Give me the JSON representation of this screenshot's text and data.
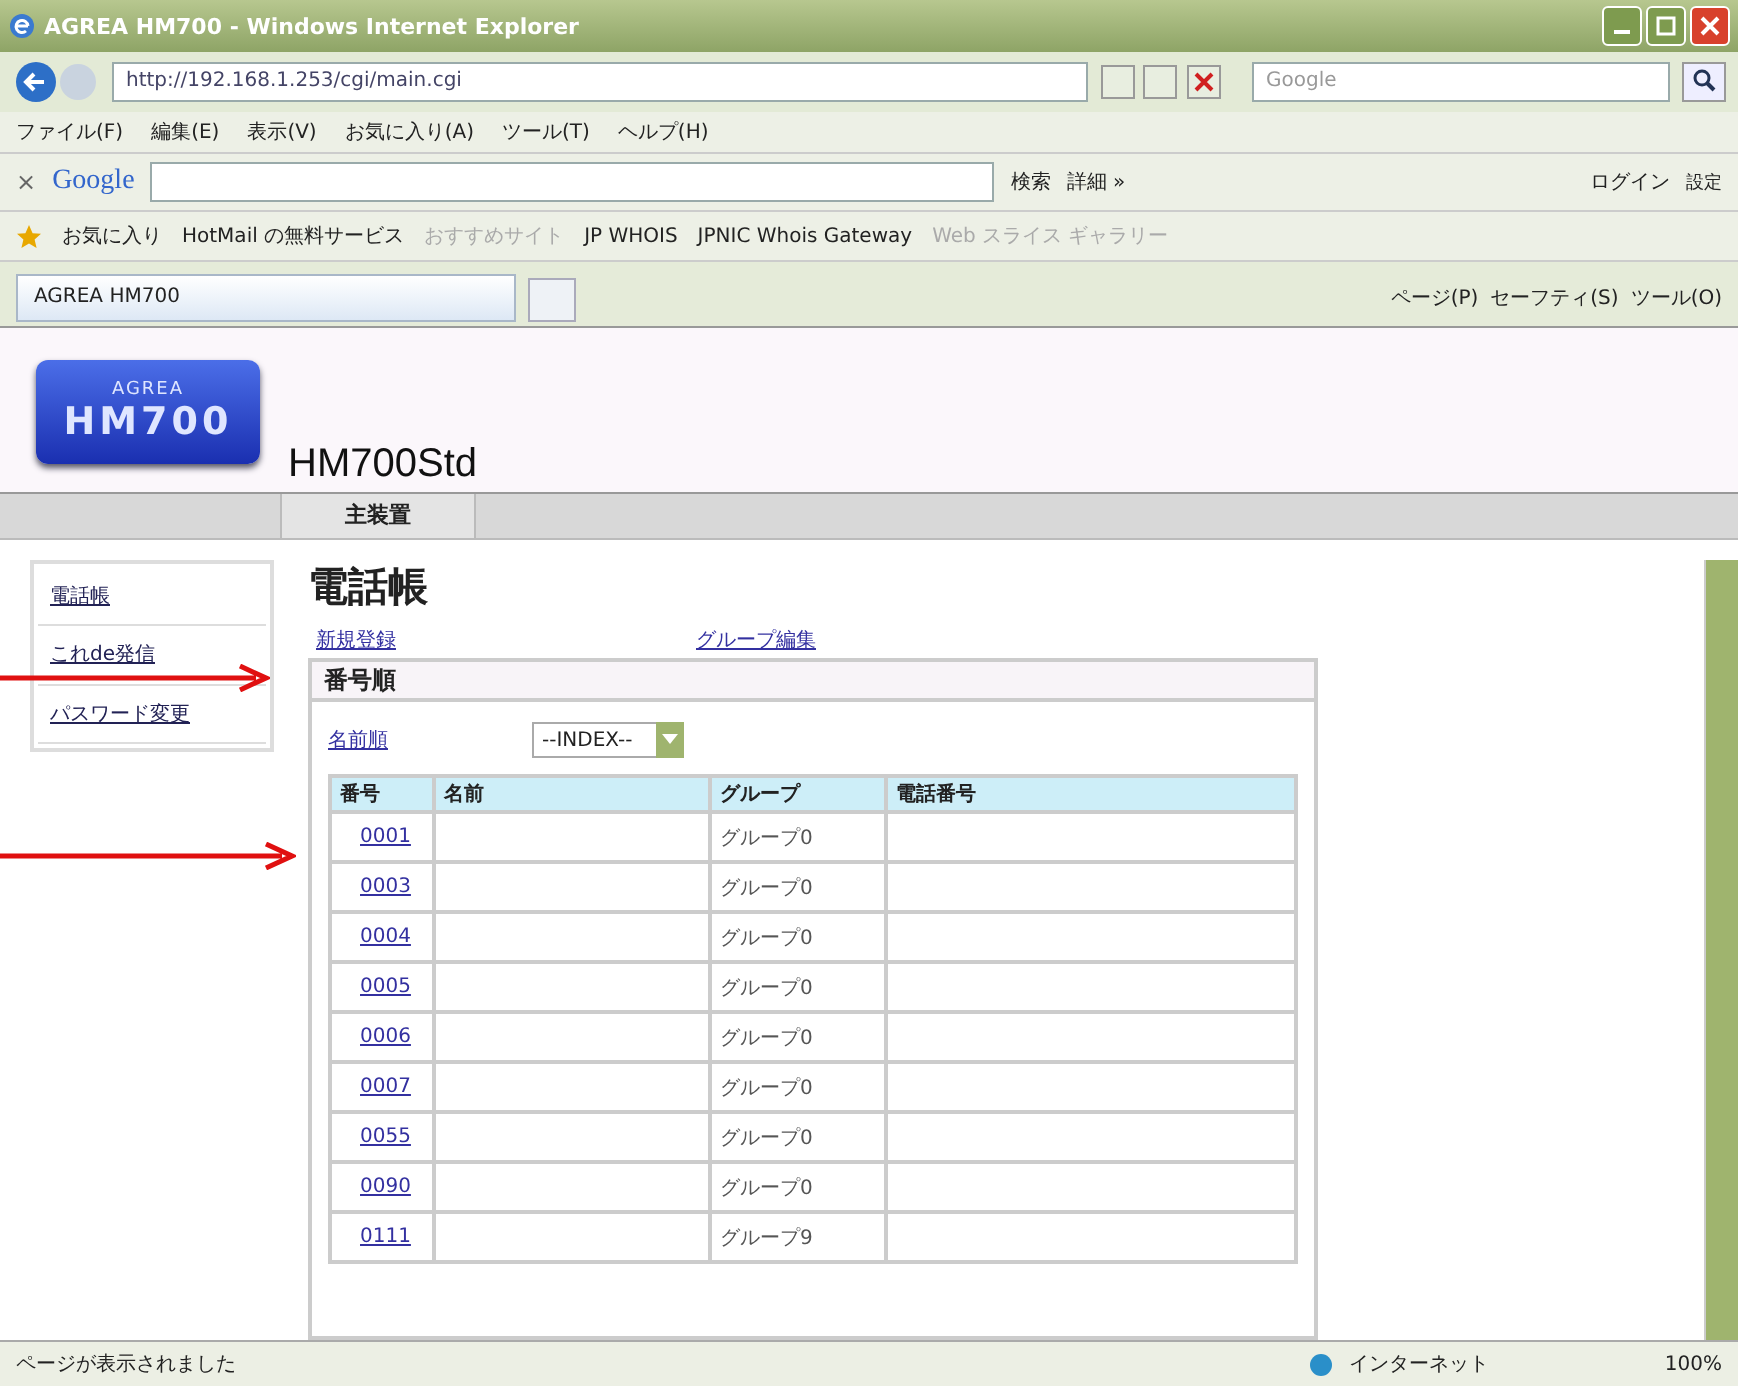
{
  "window": {
    "title": "AGREA HM700 - Windows Internet Explorer"
  },
  "address_bar": {
    "url": "http://192.168.1.253/cgi/main.cgi",
    "search_placeholder": "Google"
  },
  "menu": [
    "ファイル(F)",
    "編集(E)",
    "表示(V)",
    "お気に入り(A)",
    "ツール(T)",
    "ヘルプ(H)"
  ],
  "google_toolbar": {
    "close": "×",
    "brand": "Google",
    "search": "検索",
    "more": "詳細 »",
    "login": "ログイン",
    "settings": "設定"
  },
  "favorites_bar": {
    "label": "お気に入り",
    "items": [
      {
        "label": "HotMail の無料サービス",
        "disabled": false
      },
      {
        "label": "おすすめサイト",
        "disabled": true
      },
      {
        "label": "JP WHOIS",
        "disabled": false
      },
      {
        "label": "JPNIC Whois Gateway",
        "disabled": false
      },
      {
        "label": "Web スライス ギャラリー",
        "disabled": true
      }
    ]
  },
  "tab": {
    "title": "AGREA HM700"
  },
  "command_bar": [
    "ページ(P)",
    "セーフティ(S)",
    "ツール(O)"
  ],
  "page": {
    "logo_top": "AGREA",
    "logo_bottom": "HM700",
    "product": "HM700Std",
    "nav_tabs": [
      {
        "label": "主装置",
        "selected": true
      }
    ],
    "sidebar": [
      "電話帳",
      "これde発信",
      "パスワード変更"
    ],
    "heading": "電話帳",
    "actions": [
      "新規登録",
      "グループ編集"
    ],
    "section_title": "番号順",
    "sort_link": "名前順",
    "index_select": "--INDEX--",
    "table": {
      "columns": [
        "番号",
        "名前",
        "グループ",
        "電話番号"
      ],
      "rows": [
        [
          "0001",
          "",
          "グループ0",
          ""
        ],
        [
          "0003",
          "",
          "グループ0",
          ""
        ],
        [
          "0004",
          "",
          "グループ0",
          ""
        ],
        [
          "0005",
          "",
          "グループ0",
          ""
        ],
        [
          "0006",
          "",
          "グループ0",
          ""
        ],
        [
          "0007",
          "",
          "グループ0",
          ""
        ],
        [
          "0055",
          "",
          "グループ0",
          ""
        ],
        [
          "0090",
          "",
          "グループ0",
          ""
        ],
        [
          "0111",
          "",
          "グループ9",
          ""
        ]
      ]
    }
  },
  "status_bar": {
    "text": "ページが表示されました",
    "zone": "インターネット",
    "zoom": "100%"
  }
}
